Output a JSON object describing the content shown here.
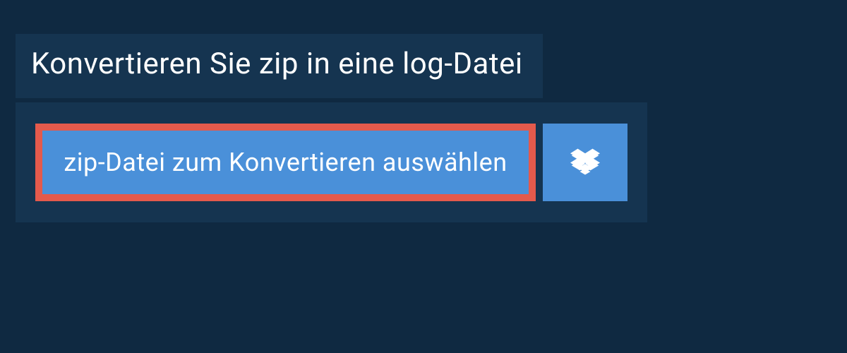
{
  "header": {
    "title": "Konvertieren Sie zip in eine log-Datei"
  },
  "actions": {
    "select_file_label": "zip-Datei zum Konvertieren auswählen",
    "dropbox_icon": "dropbox"
  },
  "colors": {
    "background": "#0f2941",
    "panel": "#153450",
    "button": "#4a90d9",
    "highlight_border": "#e45a4c",
    "text": "#ffffff"
  }
}
